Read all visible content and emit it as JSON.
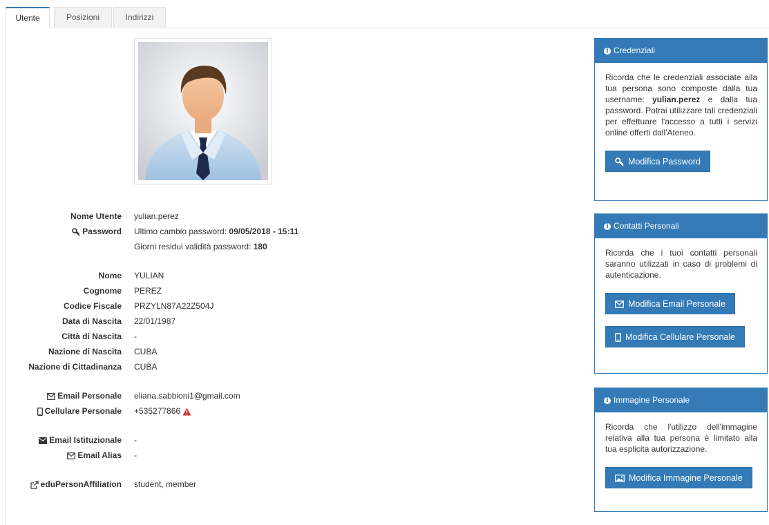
{
  "tabs": [
    {
      "label": "Utente",
      "active": true
    },
    {
      "label": "Posizioni",
      "active": false
    },
    {
      "label": "Indirizzi",
      "active": false
    }
  ],
  "profile": {
    "username_label": "Nome Utente",
    "username": "yulian.perez",
    "password_label": "Password",
    "pwd_change_prefix": "Ultimo cambio password: ",
    "pwd_change_value": "09/05/2018 - 15:11",
    "pwd_days_prefix": "Giorni residui validità password: ",
    "pwd_days_value": "180",
    "nome_label": "Nome",
    "nome": "YULIAN",
    "cognome_label": "Cognome",
    "cognome": "PEREZ",
    "cf_label": "Codice Fiscale",
    "cf": "PRZYLN87A22Z504J",
    "dob_label": "Data di Nascita",
    "dob": "22/01/1987",
    "birth_city_label": "Città di Nascita",
    "birth_city": "-",
    "birth_country_label": "Nazione di Nascita",
    "birth_country": "CUBA",
    "citizenship_label": "Nazione di Cittadinanza",
    "citizenship": "CUBA",
    "email_personal_label": "Email Personale",
    "email_personal": "eliana.sabbioni1@gmail.com",
    "mobile_label": "Cellulare Personale",
    "mobile": "+535277866",
    "email_inst_label": "Email Istituzionale",
    "email_inst": "-",
    "email_alias_label": "Email Alias",
    "email_alias": "-",
    "affiliation_label": "eduPersonAffiliation",
    "affiliation": "student, member"
  },
  "panels": {
    "credentials": {
      "title": "Credenziali",
      "text_before": "Ricorda che le credenziali associate alla tua persona sono composte dalla tua username: ",
      "username": "yulian.perez",
      "text_after": " e dalla tua password. Potrai utilizzare tali credenziali per effettuare l'accesso a tutti i servizi online offerti dall'Ateneo.",
      "button": "Modifica Password"
    },
    "contacts": {
      "title": "Contatti Personali",
      "text": "Ricorda che i tuoi contatti personali saranno utilizzati in caso di problemi di autenticazione.",
      "button_email": "Modifica Email Personale",
      "button_mobile": "Modifica Cellulare Personale"
    },
    "image": {
      "title": "Immagine Personale",
      "text": "Ricorda che l'utilizzo dell'immagine relativa alla tua persona è limitato alla tua esplicita autorizzazione.",
      "button": "Modifica Immagine Personale"
    }
  },
  "colors": {
    "primary": "#337ab7",
    "warning": "#c9302c"
  }
}
